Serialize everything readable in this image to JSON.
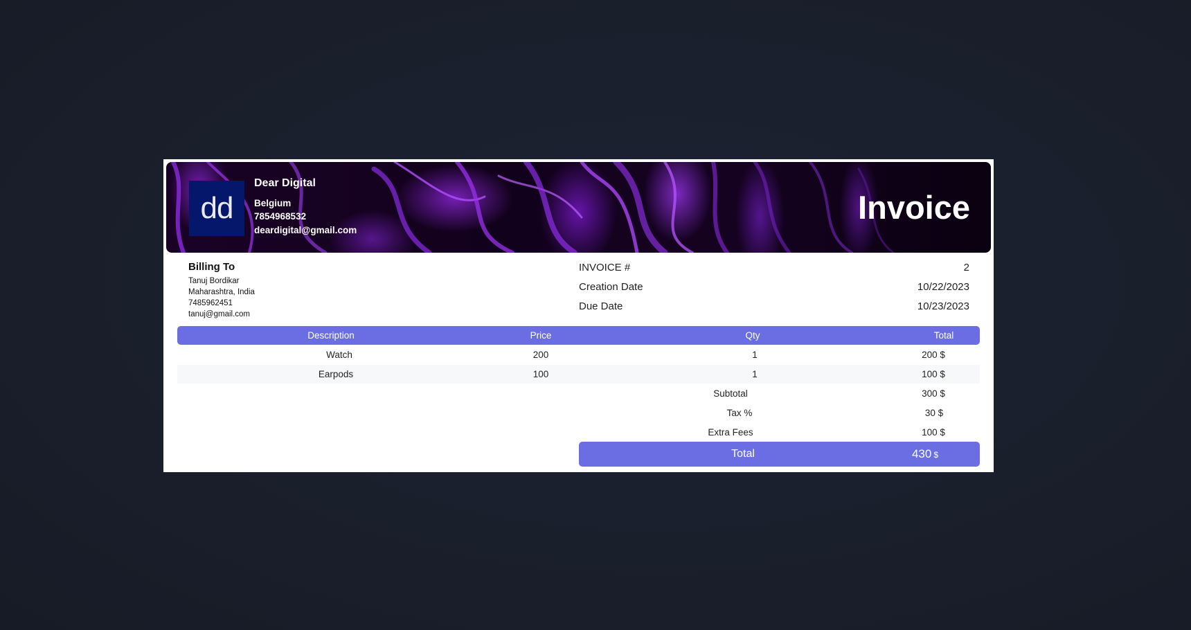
{
  "company": {
    "logo_text": "dd",
    "name": "Dear Digital",
    "country": "Belgium",
    "phone": "7854968532",
    "email": "deardigital@gmail.com"
  },
  "title": "Invoice",
  "billing": {
    "heading": "Billing To",
    "name": "Tanuj Bordikar",
    "location": "Maharashtra, India",
    "phone": "7485962451",
    "email": "tanuj@gmail.com"
  },
  "meta": [
    {
      "label": "INVOICE #",
      "value": "2"
    },
    {
      "label": "Creation Date",
      "value": "10/22/2023"
    },
    {
      "label": "Due Date",
      "value": "10/23/2023"
    }
  ],
  "items_header": {
    "description": "Description",
    "price": "Price",
    "qty": "Qty",
    "total": "Total"
  },
  "items": [
    {
      "description": "Watch",
      "price": "200",
      "qty": "1",
      "total": "200 $"
    },
    {
      "description": "Earpods",
      "price": "100",
      "qty": "1",
      "total": "100 $"
    }
  ],
  "summary": [
    {
      "label": "Subtotal",
      "value": "300 $"
    },
    {
      "label": "Tax %",
      "value": "30 $"
    },
    {
      "label": "Extra Fees",
      "value": "100 $"
    }
  ],
  "grand_total": {
    "label": "Total",
    "value": "430",
    "currency": "$"
  },
  "colors": {
    "accent": "#6a6ee2",
    "logo_bg": "#04176b",
    "page_bg": "#1a1f2c",
    "banner_purple": "#8a2be2"
  }
}
